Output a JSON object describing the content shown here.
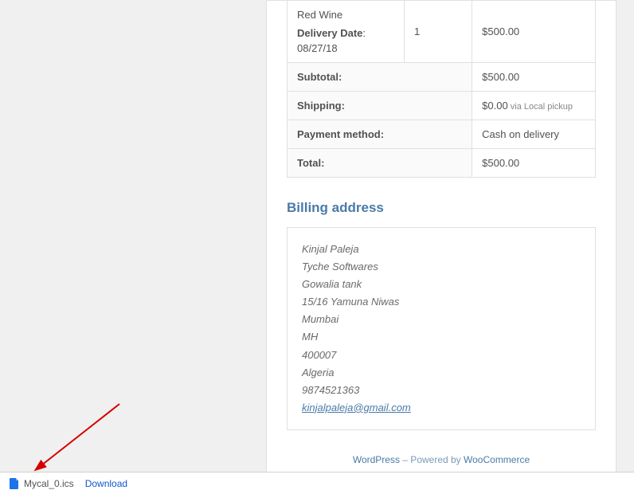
{
  "order": {
    "product_name": "Red Wine",
    "delivery_label": "Delivery Date",
    "delivery_date": "08/27/18",
    "qty": "1",
    "line_total": "$500.00",
    "rows": {
      "subtotal": {
        "label": "Subtotal:",
        "value": "$500.00"
      },
      "shipping": {
        "label": "Shipping:",
        "value": "$0.00",
        "via": " via Local pickup"
      },
      "payment": {
        "label": "Payment method:",
        "value": "Cash on delivery"
      },
      "total": {
        "label": "Total:",
        "value": "$500.00"
      }
    }
  },
  "billing": {
    "heading": "Billing address",
    "name": "Kinjal Paleja",
    "company": "Tyche Softwares",
    "street1": "Gowalia tank",
    "street2": "15/16 Yamuna Niwas",
    "city": "Mumbai",
    "state": "MH",
    "zip": "400007",
    "country": "Algeria",
    "phone": "9874521363",
    "email": "kinjalpaleja@gmail.com"
  },
  "footer": {
    "wp": "WordPress",
    "sep": " – Powered by ",
    "woo": "WooCommerce"
  },
  "download": {
    "filename": "Mycal_0.ics",
    "link": "Download"
  }
}
